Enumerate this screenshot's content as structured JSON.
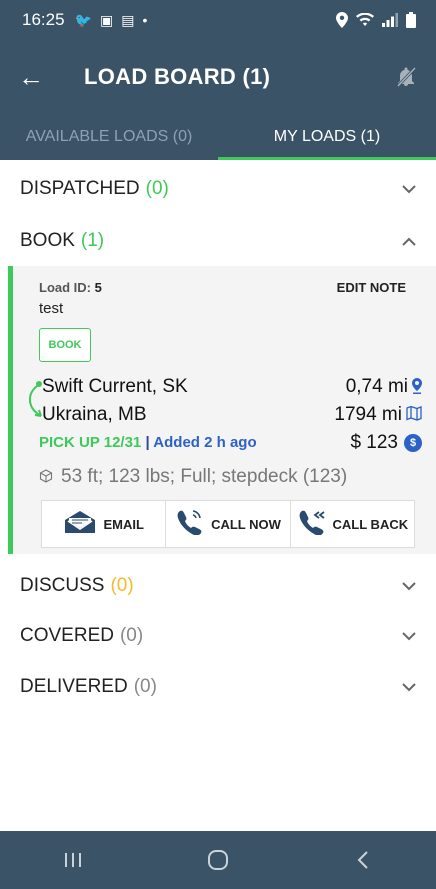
{
  "statusbar": {
    "time": "16:25"
  },
  "appbar": {
    "back": "←",
    "title": "LOAD BOARD (1)"
  },
  "tabs": [
    {
      "label": "AVAILABLE LOADS (0)",
      "active": false
    },
    {
      "label": "MY LOADS (1)",
      "active": true
    }
  ],
  "sections": {
    "dispatched": {
      "label": "DISPATCHED",
      "count": "(0)"
    },
    "book": {
      "label": "BOOK",
      "count": "(1)"
    },
    "discuss": {
      "label": "DISCUSS",
      "count": "(0)"
    },
    "covered": {
      "label": "COVERED",
      "count": "(0)"
    },
    "delivered": {
      "label": "DELIVERED",
      "count": "(0)"
    }
  },
  "load": {
    "id_label": "Load ID:",
    "id": "5",
    "edit_note": "EDIT NOTE",
    "note": "test",
    "status_badge": "BOOK",
    "origin": "Swift Current, SK",
    "origin_dist": "0,74 mi",
    "destination": "Ukraina, MB",
    "dest_dist": "1794 mi",
    "pickup": "PICK UP 12/31",
    "sep": "|",
    "added": "Added 2 h ago",
    "price": "$ 123",
    "details": "53 ft; 123 lbs; Full; stepdeck (123)"
  },
  "actions": {
    "email": "EMAIL",
    "call_now": "CALL NOW",
    "call_back": "CALL BACK"
  },
  "colors": {
    "header": "#3b5366",
    "accent_green": "#3ec95b",
    "accent_blue": "#2c62c8",
    "discuss_orange": "#f5b92a"
  }
}
